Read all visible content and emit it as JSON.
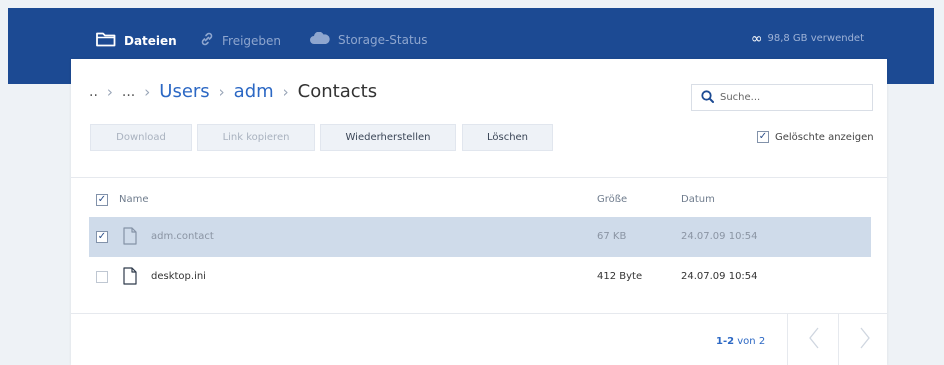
{
  "nav": {
    "files": "Dateien",
    "share": "Freigeben",
    "storage": "Storage-Status",
    "usage": "98,8 GB verwendet"
  },
  "breadcrumb": {
    "root": "..",
    "ellipsis": "...",
    "items": [
      "Users",
      "adm"
    ],
    "current": "Contacts"
  },
  "search": {
    "placeholder": "Suche..."
  },
  "toolbar": {
    "download": "Download",
    "link_copy": "Link kopieren",
    "restore": "Wiederherstellen",
    "delete": "Löschen",
    "show_deleted": "Gelöschte anzeigen"
  },
  "table": {
    "headers": {
      "name": "Name",
      "size": "Größe",
      "date": "Datum"
    },
    "rows": [
      {
        "name": "adm.contact",
        "size": "67 KB",
        "date": "24.07.09 10:54",
        "selected": true
      },
      {
        "name": "desktop.ini",
        "size": "412 Byte",
        "date": "24.07.09 10:54",
        "selected": false
      }
    ]
  },
  "pager": {
    "range": "1-2",
    "of_label": "von 2"
  },
  "colors": {
    "header_bg": "#1c4a93",
    "accent": "#2c68c4",
    "selected_row": "#cfdbea"
  }
}
